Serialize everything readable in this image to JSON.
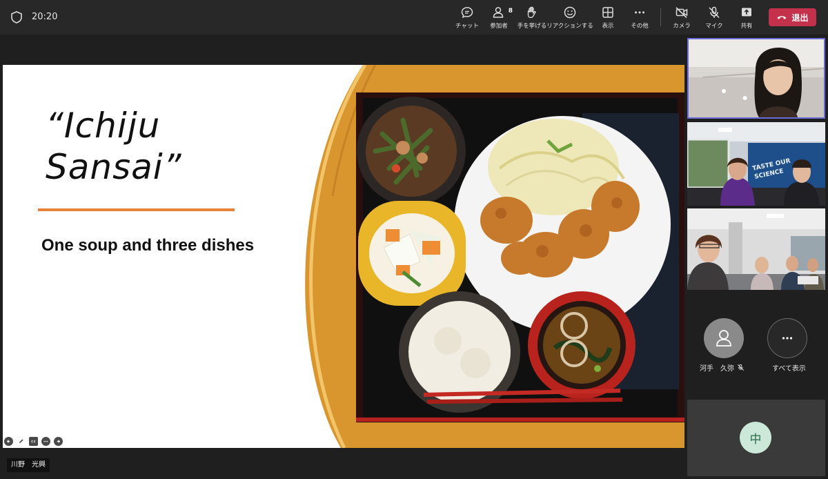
{
  "header": {
    "time": "20:20",
    "tools": [
      {
        "key": "chat",
        "label": "チャット"
      },
      {
        "key": "participants",
        "label": "参加者",
        "count": "8"
      },
      {
        "key": "raise-hand",
        "label": "手を挙げる"
      },
      {
        "key": "reactions",
        "label": "リアクションする"
      },
      {
        "key": "view",
        "label": "表示"
      },
      {
        "key": "more",
        "label": "その他"
      },
      {
        "key": "camera",
        "label": "カメラ"
      },
      {
        "key": "mic",
        "label": "マイク"
      },
      {
        "key": "share",
        "label": "共有"
      }
    ],
    "leave_label": "退出",
    "leave_color": "#c4314b"
  },
  "slide": {
    "title_line1": "“Ichiju",
    "title_line2": "Sansai”",
    "subtitle": "One soup and three dishes",
    "rule_color": "#e8823a"
  },
  "presenter_name": "川野　光興",
  "participants": {
    "avatar_name": "河手　久弥",
    "show_all_label": "すべて表示",
    "self_initial": "中"
  }
}
